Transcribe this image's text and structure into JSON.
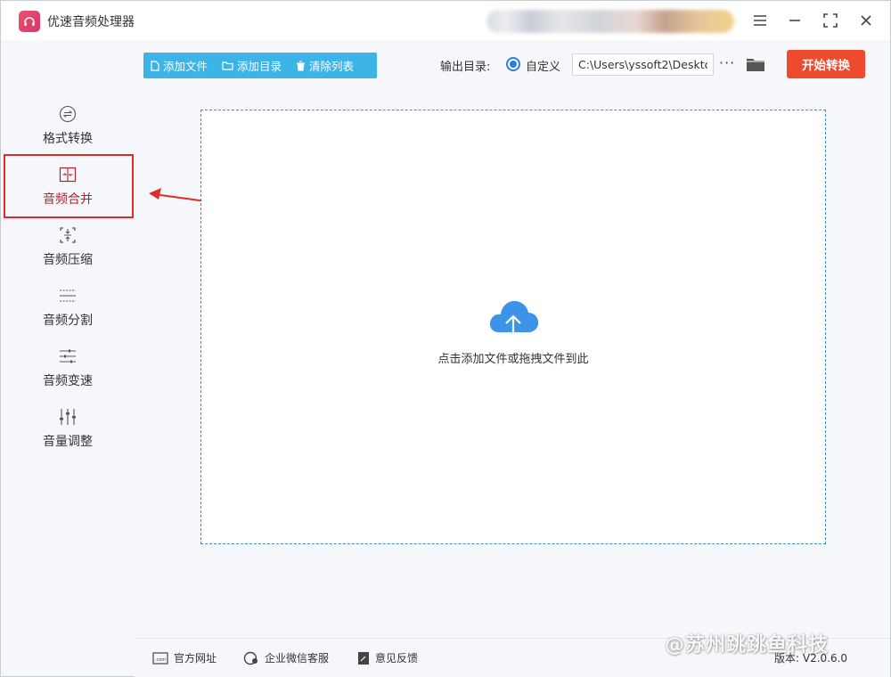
{
  "app": {
    "title": "优速音频处理器"
  },
  "toolbar": {
    "add_file": "添加文件",
    "add_dir": "添加目录",
    "clear_list": "清除列表",
    "output_label": "输出目录:",
    "output_option": "自定义",
    "output_path": "C:\\Users\\yssoft2\\Deskto",
    "more": "···",
    "start": "开始转换"
  },
  "sidebar": {
    "items": [
      {
        "label": "格式转换",
        "icon": "format-convert-icon"
      },
      {
        "label": "音频合并",
        "icon": "audio-merge-icon",
        "active": true
      },
      {
        "label": "音频压缩",
        "icon": "audio-compress-icon"
      },
      {
        "label": "音频分割",
        "icon": "audio-split-icon"
      },
      {
        "label": "音频变速",
        "icon": "audio-speed-icon"
      },
      {
        "label": "音量调整",
        "icon": "volume-adjust-icon"
      }
    ]
  },
  "drop": {
    "hint": "点击添加文件或拖拽文件到此"
  },
  "footer": {
    "website": "官方网址",
    "wechat": "企业微信客服",
    "feedback": "意见反馈",
    "version": "版本: V2.0.6.0"
  },
  "watermark": "@苏州跳跳鱼科技",
  "colors": {
    "accent": "#3db4e8",
    "start": "#ee4a2d",
    "highlight": "#e02b2b"
  }
}
